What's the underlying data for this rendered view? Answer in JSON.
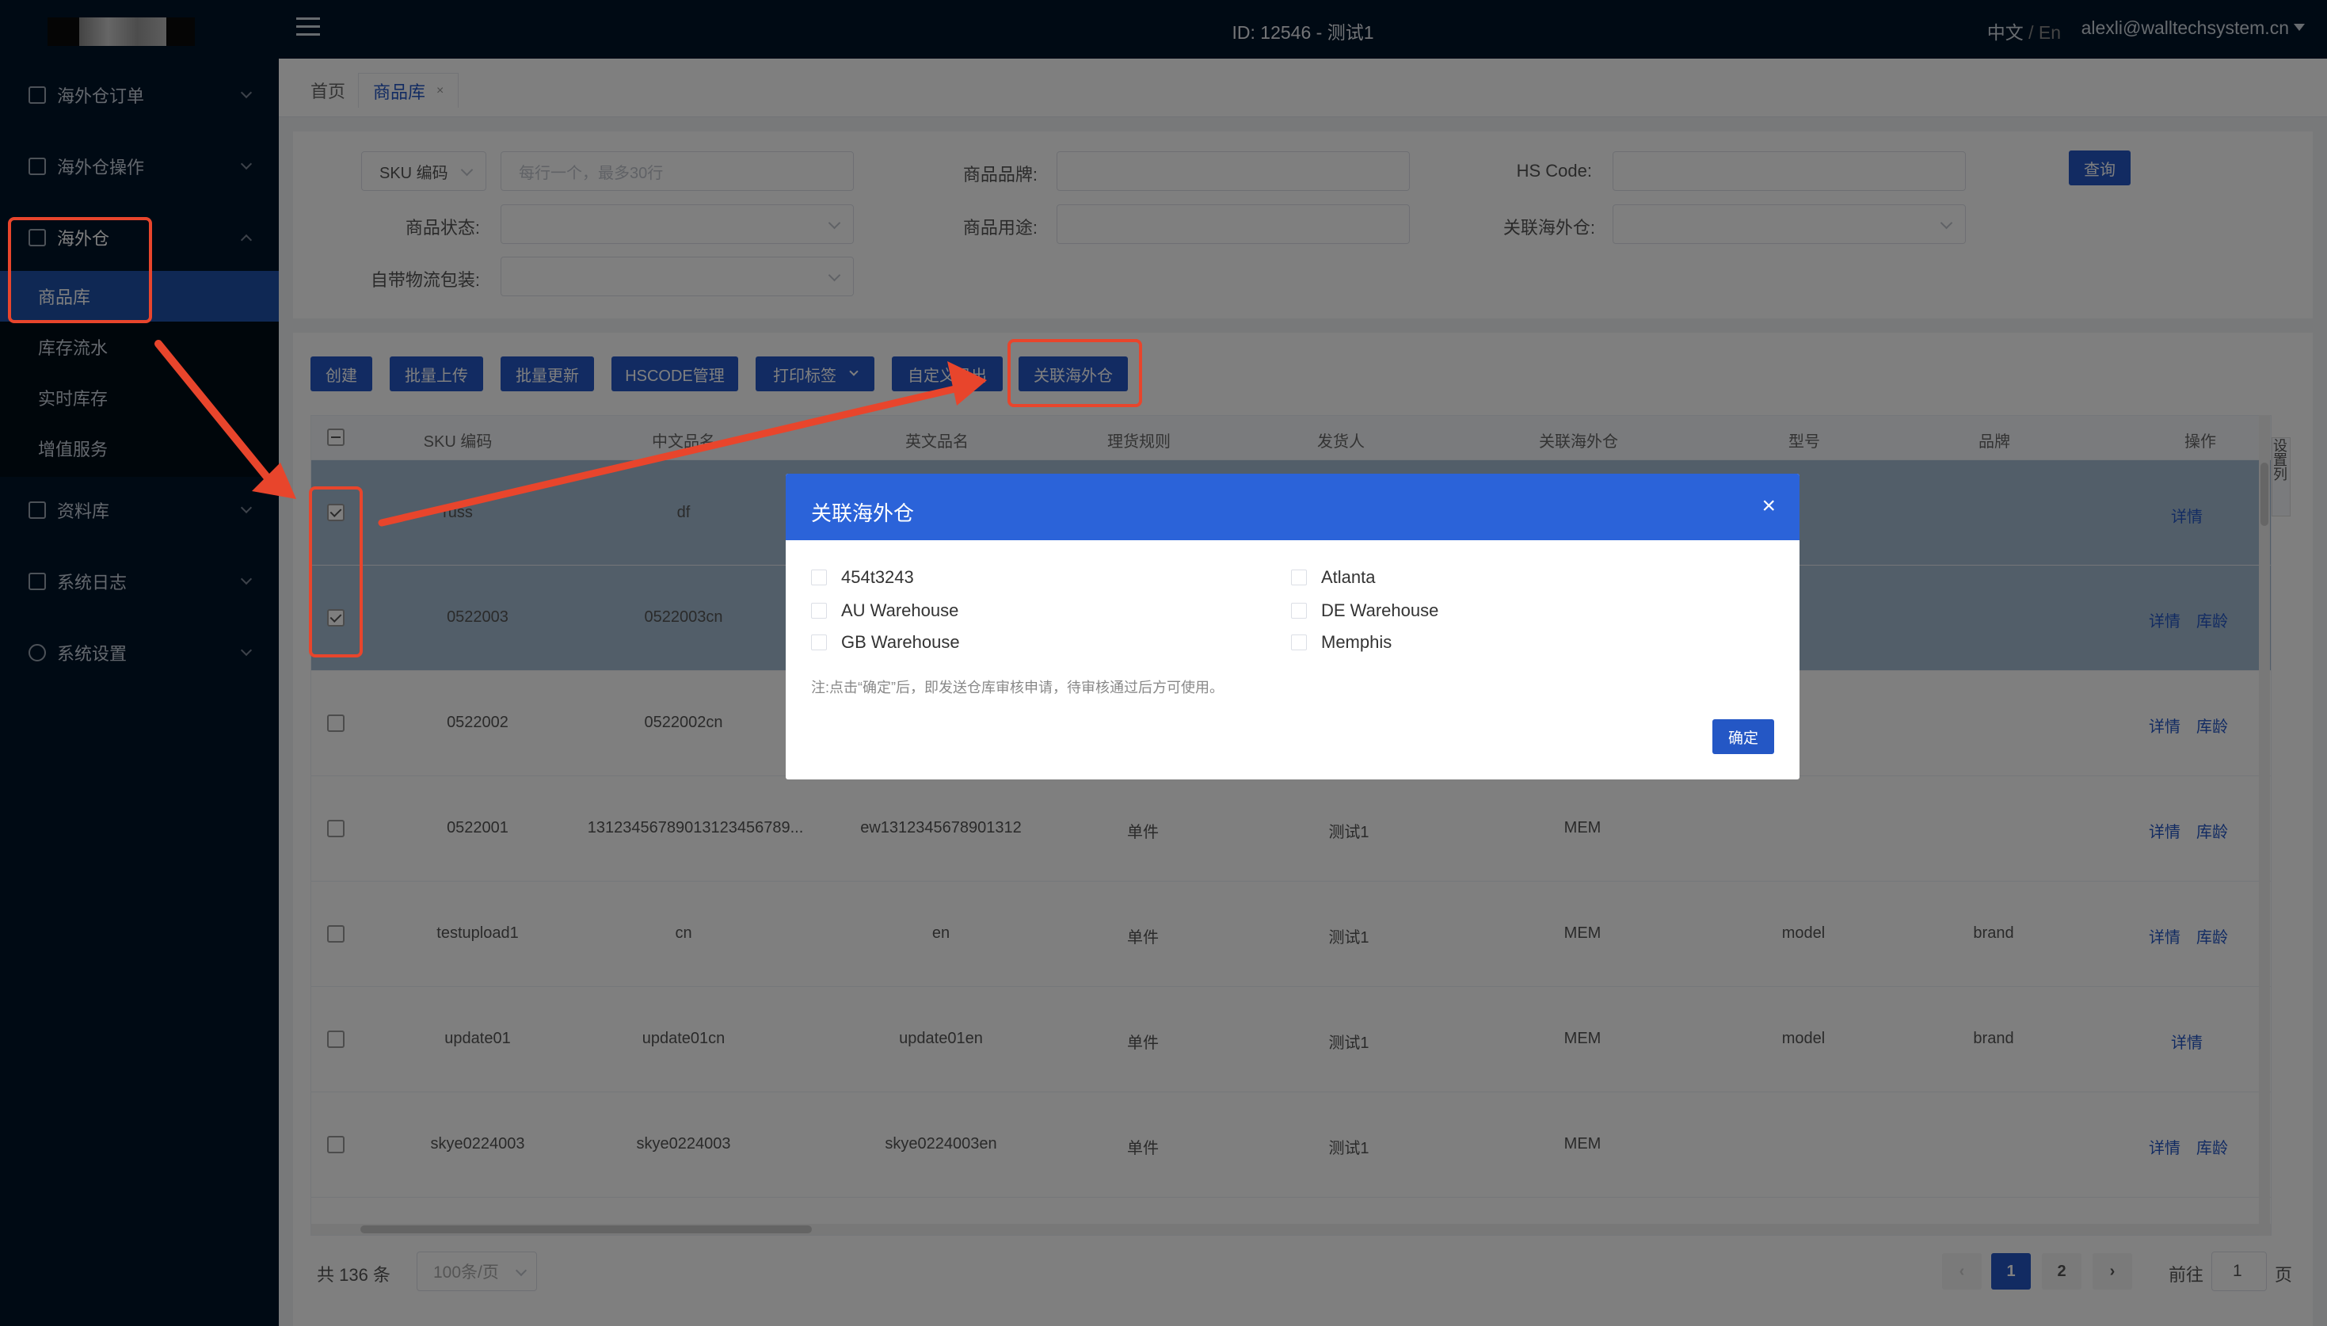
{
  "header": {
    "title": "ID: 12546 - 测试1",
    "lang_zh": "中文",
    "lang_sep": " / ",
    "lang_en": "En",
    "user_email": "alexli@walltechsystem.cn"
  },
  "sidebar": {
    "items": [
      {
        "label": "海外仓订单",
        "icon": "order-icon"
      },
      {
        "label": "海外仓操作",
        "icon": "operation-icon"
      },
      {
        "label": "海外仓",
        "icon": "warehouse-icon"
      },
      {
        "label": "资料库",
        "icon": "database-icon"
      },
      {
        "label": "系统日志",
        "icon": "log-icon"
      },
      {
        "label": "系统设置",
        "icon": "gear-icon"
      }
    ],
    "sub_items": [
      "商品库",
      "库存流水",
      "实时库存",
      "增值服务"
    ]
  },
  "tabs": {
    "home": "首页",
    "current": "商品库",
    "close": "×"
  },
  "filter": {
    "sku_select": "SKU 编码",
    "sku_placeholder": "每行一个，最多30行",
    "brand_label": "商品品牌:",
    "hscode_label": "HS Code:",
    "status_label": "商品状态:",
    "usage_label": "商品用途:",
    "linked_label": "关联海外仓:",
    "packaging_label": "自带物流包装:",
    "query_button": "查询"
  },
  "toolbar": {
    "create": "创建",
    "batch_upload": "批量上传",
    "batch_update": "批量更新",
    "hscode_manage": "HSCODE管理",
    "print_label": "打印标签",
    "custom_export": "自定义导出",
    "link_warehouse": "关联海外仓"
  },
  "table": {
    "columns": [
      "SKU 编码",
      "中文品名",
      "英文品名",
      "理货规则",
      "发货人",
      "关联海外仓",
      "型号",
      "品牌",
      "操作"
    ],
    "settings_label": "设置列",
    "rows": [
      {
        "sku": "russ",
        "cn": "df",
        "en": "",
        "rule": "",
        "shipper": "",
        "wh": "",
        "model": "",
        "brand": "",
        "actions": [
          "详情"
        ],
        "checked": true
      },
      {
        "sku": "0522003",
        "cn": "0522003cn",
        "en": "",
        "rule": "",
        "shipper": "",
        "wh": "",
        "model": "",
        "brand": "",
        "actions": [
          "详情",
          "库龄"
        ],
        "checked": true
      },
      {
        "sku": "0522002",
        "cn": "0522002cn",
        "en": "",
        "rule": "",
        "shipper": "",
        "wh": "",
        "model": "",
        "brand": "",
        "actions": [
          "详情",
          "库龄"
        ],
        "checked": false
      },
      {
        "sku": "0522001",
        "cn": "13123456789013123456789...",
        "en": "ew1312345678901312",
        "rule": "单件",
        "shipper": "测试1",
        "wh": "MEM",
        "model": "",
        "brand": "",
        "actions": [
          "详情",
          "库龄"
        ],
        "checked": false
      },
      {
        "sku": "testupload1",
        "cn": "cn",
        "en": "en",
        "rule": "单件",
        "shipper": "测试1",
        "wh": "MEM",
        "model": "model",
        "brand": "brand",
        "actions": [
          "详情",
          "库龄"
        ],
        "checked": false
      },
      {
        "sku": "update01",
        "cn": "update01cn",
        "en": "update01en",
        "rule": "单件",
        "shipper": "测试1",
        "wh": "MEM",
        "model": "model",
        "brand": "brand",
        "actions": [
          "详情"
        ],
        "checked": false
      },
      {
        "sku": "skye0224003",
        "cn": "skye0224003",
        "en": "skye0224003en",
        "rule": "单件",
        "shipper": "测试1",
        "wh": "MEM",
        "model": "",
        "brand": "",
        "actions": [
          "详情",
          "库龄"
        ],
        "checked": false
      }
    ]
  },
  "pagination": {
    "total": "共 136 条",
    "page_size": "100条/页",
    "pages": [
      "1",
      "2"
    ],
    "prev": "‹",
    "next": "›",
    "goto_label": "前往",
    "goto_value": "1",
    "goto_suffix": "页"
  },
  "dialog": {
    "title": "关联海外仓",
    "close": "×",
    "options": [
      "454t3243",
      "Atlanta",
      "AU Warehouse",
      "DE Warehouse",
      "GB Warehouse",
      "Memphis"
    ],
    "note": "注:点击“确定”后，即发送仓库审核申请，待审核通过后方可使用。",
    "confirm": "确定"
  },
  "colors": {
    "primary": "#2457c5",
    "sidebar": "#001529",
    "annotation": "#e8452c",
    "selected_row": "#a4bdd2"
  }
}
